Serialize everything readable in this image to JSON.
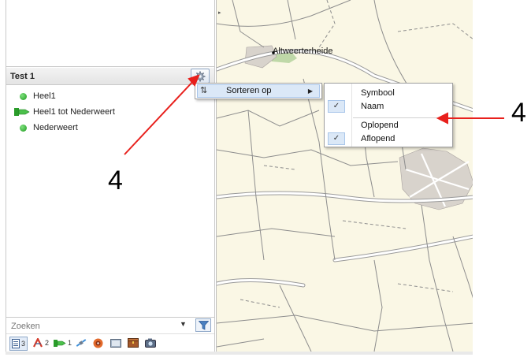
{
  "layer_panel": {
    "title": "Test 1",
    "items": [
      {
        "label": "Heel1",
        "icon": "green-dot-icon"
      },
      {
        "label": "Heel1 tot Nederweert",
        "icon": "route-icon"
      },
      {
        "label": "Nederweert",
        "icon": "green-dot-icon"
      }
    ],
    "search_placeholder": "Zoeken",
    "toolbar": [
      {
        "icon": "list-icon",
        "count": "3"
      },
      {
        "icon": "track-icon",
        "count": "2"
      },
      {
        "icon": "route-icon",
        "count": "1"
      },
      {
        "icon": "satellite-icon",
        "count": ""
      },
      {
        "icon": "disc-icon",
        "count": ""
      },
      {
        "icon": "photo-icon",
        "count": ""
      },
      {
        "icon": "chest-icon",
        "count": ""
      },
      {
        "icon": "camera-icon",
        "count": ""
      }
    ]
  },
  "context_menu": {
    "item_label": "Sorteren op"
  },
  "submenu": {
    "items": [
      {
        "label": "Symbool",
        "checked": false
      },
      {
        "label": "Naam",
        "checked": true
      },
      {
        "label": "Oplopend",
        "checked": false
      },
      {
        "label": "Aflopend",
        "checked": true
      }
    ]
  },
  "map": {
    "place_label": "Altweerterheide"
  },
  "annotations": {
    "left": "4",
    "right": "4",
    "arrow_color": "#e8201c"
  },
  "colors": {
    "map_background": "#faf7e5",
    "road": "#ffffff",
    "road_outline": "#9a9a9a",
    "highlight": "#dbe8f7"
  }
}
